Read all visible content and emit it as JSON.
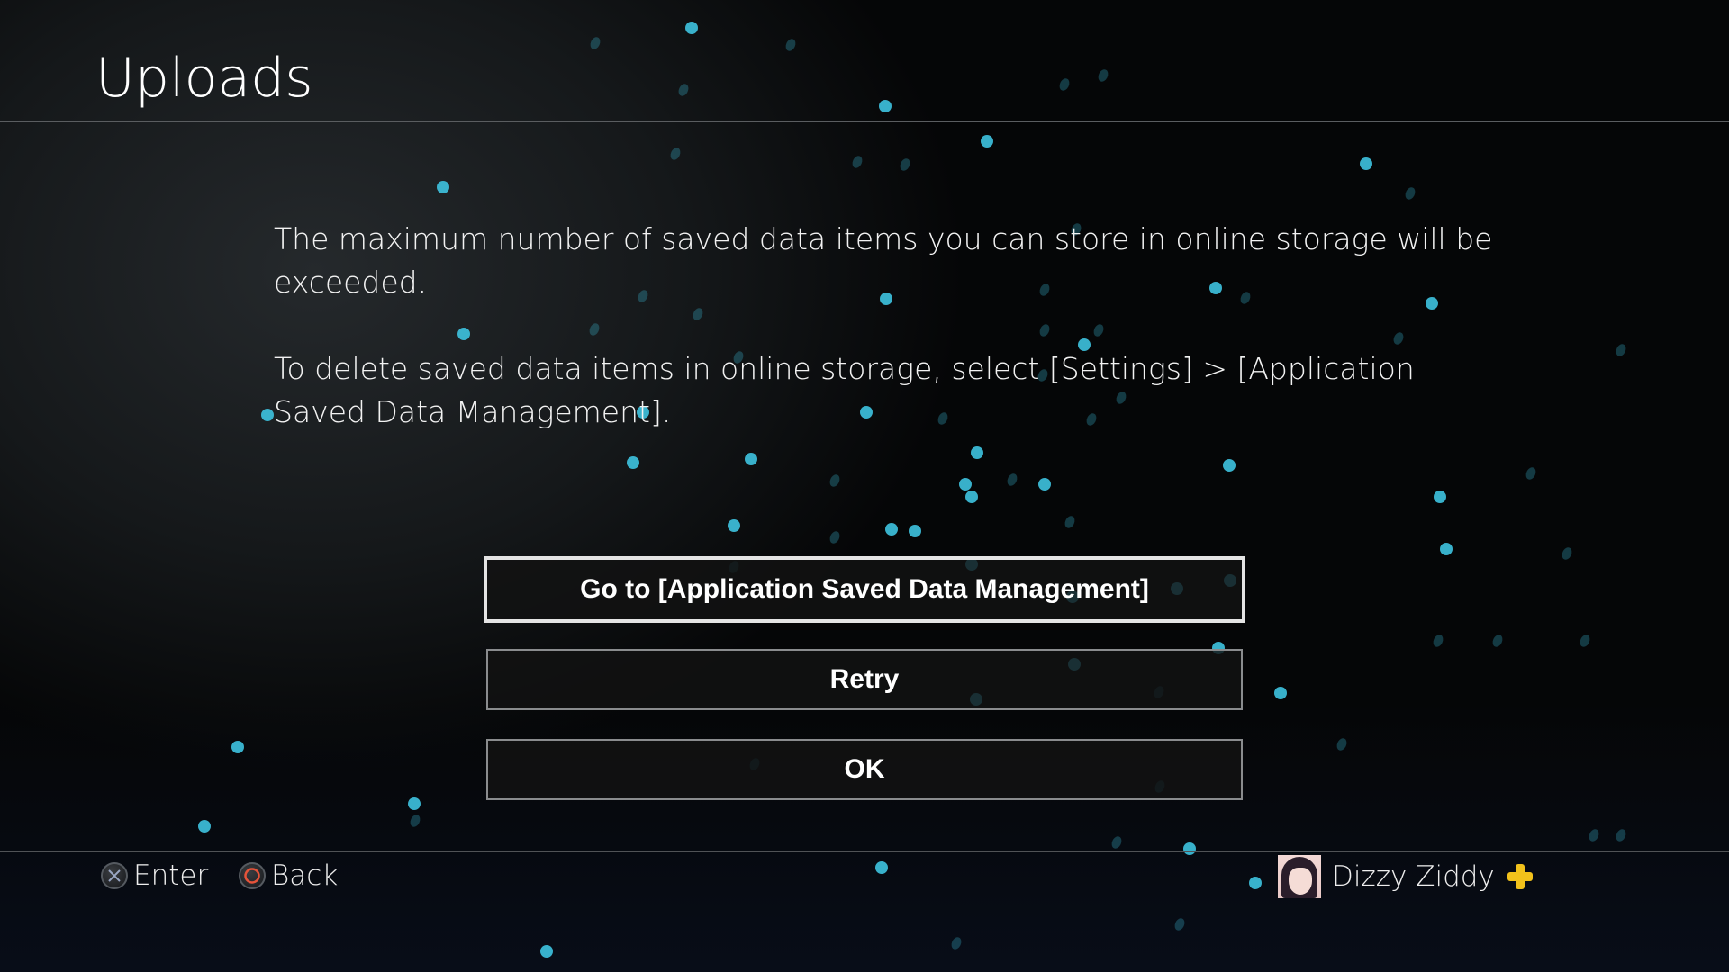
{
  "header": {
    "title": "Uploads"
  },
  "message": {
    "paragraphs": [
      "The maximum number of saved data items you can store in online storage will be exceeded.",
      "To delete saved data items in online storage, select [Settings] > [Application Saved Data Management]."
    ]
  },
  "buttons": [
    {
      "label": "Go to [Application Saved Data Management]",
      "focused": true
    },
    {
      "label": "Retry",
      "focused": false
    },
    {
      "label": "OK",
      "focused": false
    }
  ],
  "footer": {
    "hints": [
      {
        "icon": "cross-button-icon",
        "label": "Enter",
        "color": "#9aa7c4"
      },
      {
        "icon": "circle-button-icon",
        "label": "Back",
        "color": "#e5533a"
      }
    ],
    "user": {
      "name": "Dizzy Ziddy",
      "badge": "playstation-plus-icon",
      "badge_color": "#f2c21b"
    }
  },
  "theme": {
    "particle_color": "#3ec3e0",
    "accent_line": "#5a5d60"
  }
}
